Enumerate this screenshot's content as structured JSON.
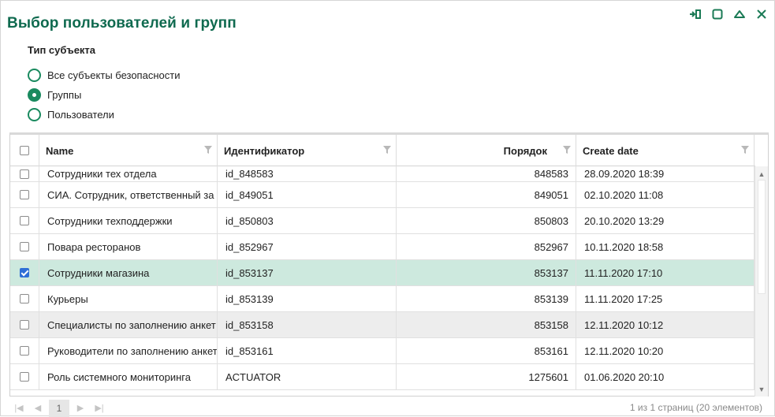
{
  "dialog": {
    "title": "Выбор пользователей и групп"
  },
  "window_controls": [
    "pin-icon",
    "maximize-icon",
    "collapse-icon",
    "close-icon"
  ],
  "subject_type": {
    "label": "Тип субъекта",
    "options": [
      {
        "label": "Все субъекты безопасности",
        "checked": false
      },
      {
        "label": "Группы",
        "checked": true
      },
      {
        "label": "Пользователи",
        "checked": false
      }
    ]
  },
  "grid": {
    "columns": [
      "Name",
      "Идентификатор",
      "Порядок",
      "Create date"
    ],
    "rows": [
      {
        "name": "Сотрудники тех отдела",
        "id": "id_848583",
        "order": "848583",
        "date": "28.09.2020 18:39",
        "checked": false
      },
      {
        "name": "СИА. Сотрудник, ответственный за АХО",
        "id": "id_849051",
        "order": "849051",
        "date": "02.10.2020 11:08",
        "checked": false
      },
      {
        "name": "Сотрудники техподдержки",
        "id": "id_850803",
        "order": "850803",
        "date": "20.10.2020 13:29",
        "checked": false
      },
      {
        "name": "Повара ресторанов",
        "id": "id_852967",
        "order": "852967",
        "date": "10.11.2020 18:58",
        "checked": false
      },
      {
        "name": "Сотрудники магазина",
        "id": "id_853137",
        "order": "853137",
        "date": "11.11.2020 17:10",
        "checked": true
      },
      {
        "name": "Курьеры",
        "id": "id_853139",
        "order": "853139",
        "date": "11.11.2020 17:25",
        "checked": false
      },
      {
        "name": "Специалисты по заполнению анкет",
        "id": "id_853158",
        "order": "853158",
        "date": "12.11.2020 10:12",
        "checked": false
      },
      {
        "name": "Руководители по заполнению анкет",
        "id": "id_853161",
        "order": "853161",
        "date": "12.11.2020 10:20",
        "checked": false
      },
      {
        "name": "Роль системного мониторинга",
        "id": "ACTUATOR",
        "order": "1275601",
        "date": "01.06.2020 20:10",
        "checked": false
      }
    ]
  },
  "pager": {
    "current_page": "1",
    "info": "1 из 1 страниц (20 элементов)"
  },
  "colors": {
    "accent": "#0f6a4f",
    "radio": "#1a8a5f",
    "selected_row": "#cde9de",
    "checkbox_on": "#2f6fd6"
  }
}
